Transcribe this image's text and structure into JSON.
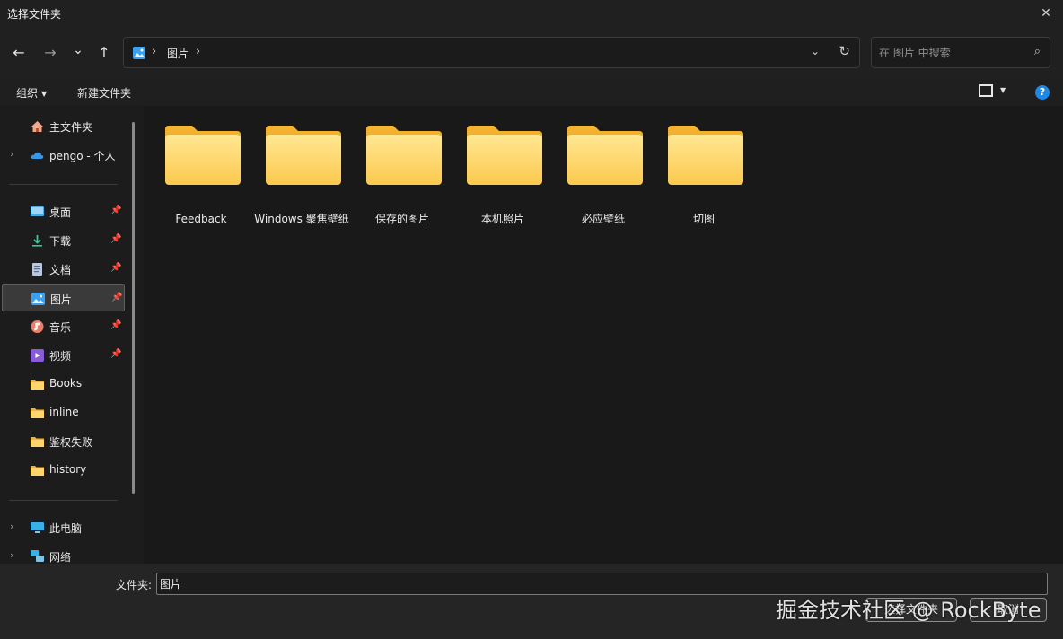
{
  "window": {
    "title": "选择文件夹",
    "close_glyph": "✕"
  },
  "nav": {
    "back_glyph": "←",
    "forward_glyph": "→",
    "recent_glyph": "⌄",
    "up_glyph": "↑",
    "breadcrumb": [
      "图片"
    ],
    "crumb_sep": "›",
    "dropdown_glyph": "⌄",
    "refresh_glyph": "↻",
    "search_placeholder": "在 图片 中搜索",
    "search_glyph": "⌕"
  },
  "commands": {
    "organize": "组织",
    "new_folder": "新建文件夹",
    "help": "?"
  },
  "sidebar": {
    "home": "主文件夹",
    "onedrive": "pengo - 个人",
    "quick_access": [
      {
        "label": "桌面",
        "icon": "desktop-icon",
        "pinned": true
      },
      {
        "label": "下载",
        "icon": "download-icon",
        "pinned": true
      },
      {
        "label": "文档",
        "icon": "document-icon",
        "pinned": true
      },
      {
        "label": "图片",
        "icon": "pictures-icon",
        "pinned": true,
        "selected": true
      },
      {
        "label": "音乐",
        "icon": "music-icon",
        "pinned": true
      },
      {
        "label": "视频",
        "icon": "video-icon",
        "pinned": true
      },
      {
        "label": "Books",
        "icon": "folder-icon",
        "pinned": false
      },
      {
        "label": "inline",
        "icon": "folder-icon",
        "pinned": false
      },
      {
        "label": "鉴权失败",
        "icon": "folder-icon",
        "pinned": false
      },
      {
        "label": "history",
        "icon": "folder-icon",
        "pinned": false
      }
    ],
    "this_pc": "此电脑",
    "network": "网络",
    "pin_glyph": "📌",
    "chevron_glyph": "›"
  },
  "folders": [
    {
      "name": "Feedback"
    },
    {
      "name": "Windows 聚焦壁纸"
    },
    {
      "name": "保存的图片"
    },
    {
      "name": "本机照片"
    },
    {
      "name": "必应壁纸"
    },
    {
      "name": "切图"
    }
  ],
  "bottom": {
    "folder_label": "文件夹:",
    "folder_value": "图片",
    "select_button": "选择文件夹",
    "cancel_button": "取消"
  },
  "watermark": "掘金技术社区 @ RockByte",
  "colors": {
    "accent": "#1e88e5",
    "folder_light": "#ffe38a",
    "folder_dark": "#f6b93b"
  }
}
